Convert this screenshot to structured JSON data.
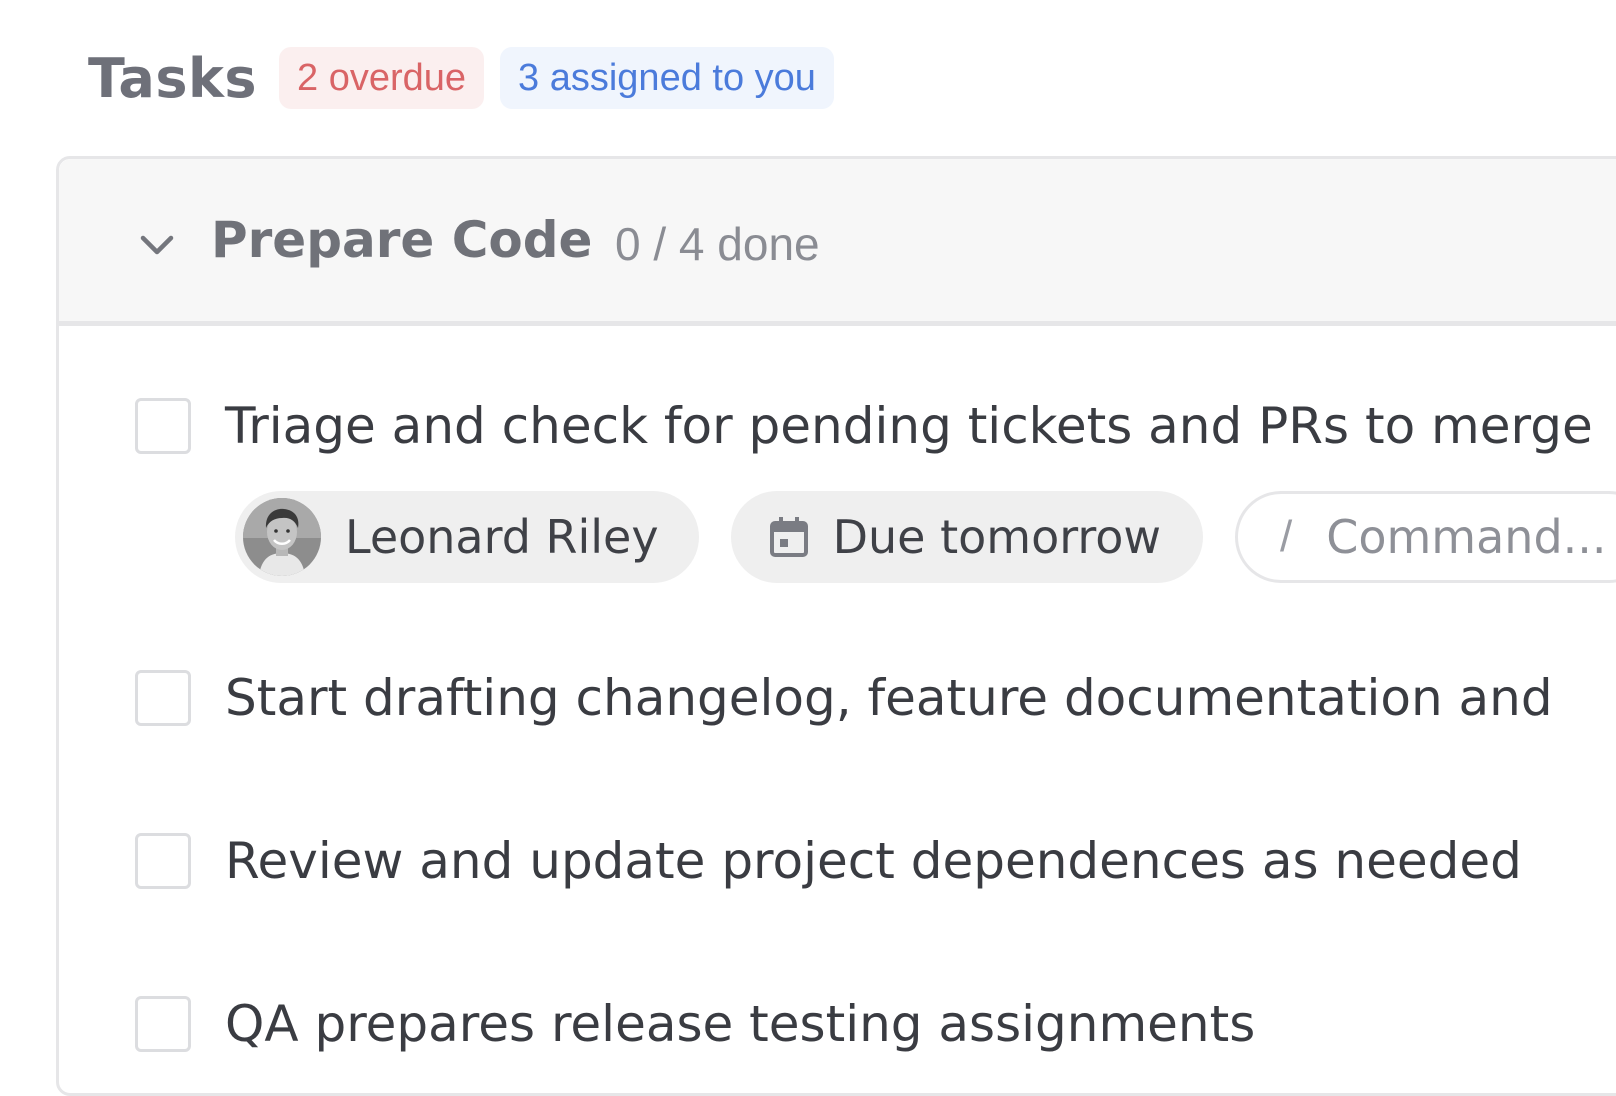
{
  "header": {
    "title": "Tasks",
    "overdue_badge": "2 overdue",
    "assigned_badge": "3 assigned to you"
  },
  "group": {
    "title": "Prepare Code",
    "progress": "0 / 4 done",
    "expanded": true
  },
  "tasks": [
    {
      "label": "Triage and check for pending tickets and PRs to merge",
      "checked": false,
      "assignee": "Leonard Riley",
      "due": "Due tomorrow",
      "command_placeholder": "Command...",
      "command_prefix": "/"
    },
    {
      "label": "Start drafting changelog, feature documentation and",
      "checked": false
    },
    {
      "label": "Review and update project dependences as needed",
      "checked": false
    },
    {
      "label": "QA prepares release testing assignments",
      "checked": false
    }
  ],
  "colors": {
    "overdue": "#d96466",
    "assigned": "#4b7bdb"
  },
  "icons": {
    "chevron": "chevron-down-icon",
    "calendar": "calendar-icon"
  }
}
